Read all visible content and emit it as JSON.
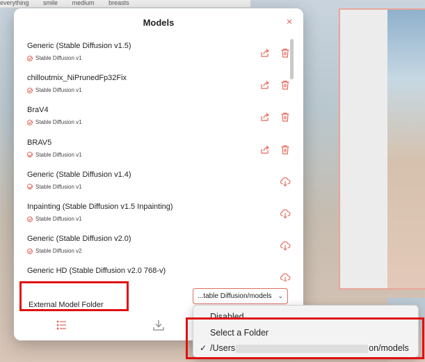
{
  "tag_bar": [
    "everything",
    "smile",
    "medium",
    "breasts"
  ],
  "modal": {
    "title": "Models",
    "close_glyph": "×"
  },
  "models": [
    {
      "name": "Generic (Stable Diffusion v1.5)",
      "version": "Stable Diffusion v1",
      "installed": true
    },
    {
      "name": "chilloutmix_NiPrunedFp32Fix",
      "version": "Stable Diffusion v1",
      "installed": true
    },
    {
      "name": "BraV4",
      "version": "Stable Diffusion v1",
      "installed": true
    },
    {
      "name": "BRAV5",
      "version": "Stable Diffusion v1",
      "installed": true
    },
    {
      "name": "Generic (Stable Diffusion v1.4)",
      "version": "Stable Diffusion v1",
      "installed": false
    },
    {
      "name": "Inpainting (Stable Diffusion v1.5 Inpainting)",
      "version": "Stable Diffusion v1",
      "installed": false
    },
    {
      "name": "Generic (Stable Diffusion v2.0)",
      "version": "Stable Diffusion v2",
      "installed": false
    },
    {
      "name": "Generic HD (Stable Diffusion v2.0 768-v)",
      "version": "",
      "installed": false
    }
  ],
  "external_folder": {
    "label": "External Model Folder",
    "selected": "...table Diffusion/models",
    "chevron": "⌄"
  },
  "dropdown": {
    "options": [
      {
        "label": "Disabled",
        "checked": false
      },
      {
        "label": "Select a Folder",
        "checked": false
      },
      {
        "label_prefix": "/Users",
        "label_suffix": "on/models",
        "checked": true
      }
    ],
    "check_glyph": "✓"
  },
  "colors": {
    "accent": "#e46b5c",
    "highlight": "#e01010"
  },
  "icons": [
    "share-icon",
    "trash-icon",
    "cloud-download-icon",
    "list-icon",
    "download-icon"
  ]
}
